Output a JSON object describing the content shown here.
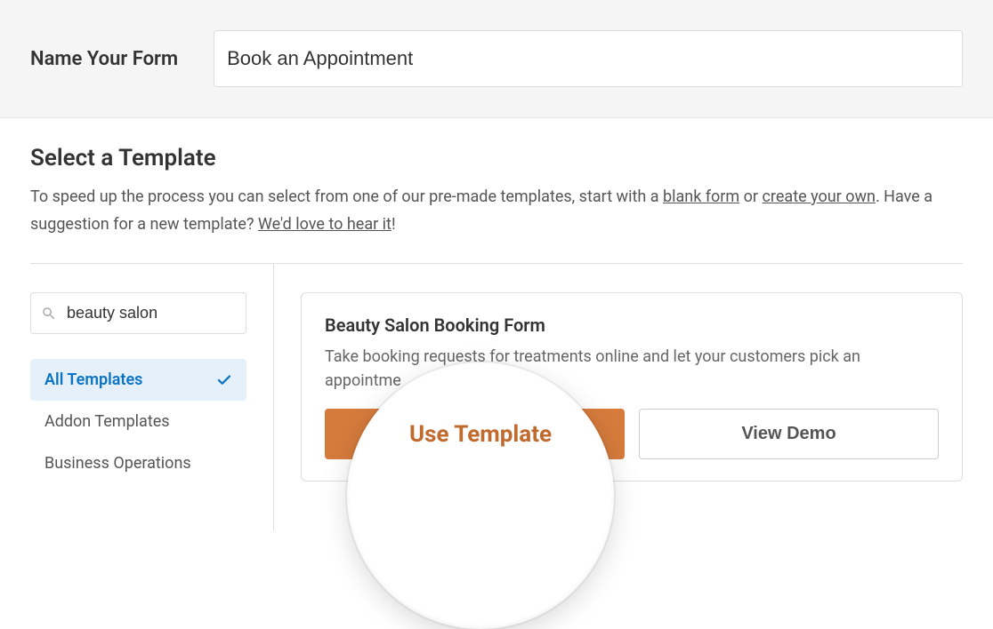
{
  "topBar": {
    "label": "Name Your Form",
    "formName": "Book an Appointment"
  },
  "section": {
    "heading": "Select a Template",
    "descParts": {
      "p1": "To speed up the process you can select from one of our pre-made templates, start with a ",
      "link1": "blank form",
      "p2": " or ",
      "link2": "create your own",
      "p3": ". Have a suggestion for a new template? ",
      "link3": "We'd love to hear it",
      "p4": "!"
    }
  },
  "search": {
    "value": "beauty salon"
  },
  "categories": [
    {
      "label": "All Templates",
      "active": true
    },
    {
      "label": "Addon Templates",
      "active": false
    },
    {
      "label": "Business Operations",
      "active": false
    }
  ],
  "template": {
    "title": "Beauty Salon Booking Form",
    "desc": "Take booking requests for treatments online and let your customers pick an appointme",
    "primaryBtn": "Use Template",
    "secondaryBtn": "View Demo"
  },
  "magnifier": {
    "text": "Use Template"
  }
}
